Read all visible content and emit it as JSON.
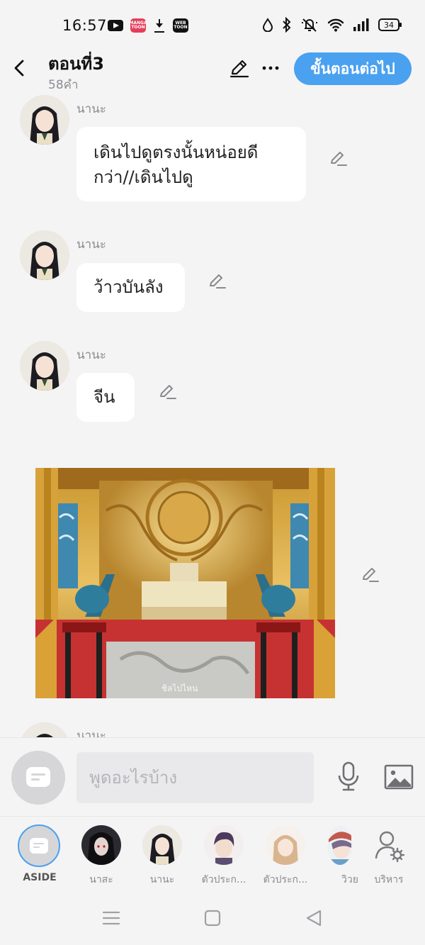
{
  "status_bar": {
    "time": "16:57",
    "app_badge_1": "MANGA TOON",
    "app_badge_2": "WEB TOON",
    "battery": "34"
  },
  "header": {
    "title": "ตอนที่3",
    "word_count": "58คำ",
    "next_button": "ขั้นตอนต่อไป"
  },
  "messages": [
    {
      "speaker": "นานะ",
      "text_lines": [
        "เดินไปดูตรงนั้นหน่อยดี",
        "กว่า//เดินไปดู"
      ]
    },
    {
      "speaker": "นานะ",
      "text": "ว้าวบันลัง"
    },
    {
      "speaker": "นานะ",
      "text": "จีน"
    },
    {
      "type": "image",
      "watermark": "ชิลไปไหน"
    },
    {
      "speaker": "นานะ"
    }
  ],
  "input": {
    "placeholder": "พูดอะไรบ้าง"
  },
  "characters": [
    {
      "label": "ASIDE",
      "icon": "chat-bubble-icon"
    },
    {
      "label": "นาสะ"
    },
    {
      "label": "นานะ"
    },
    {
      "label": "ตัวประก..."
    },
    {
      "label": "ตัวประก..."
    },
    {
      "label": "วิวย"
    },
    {
      "label": "บริหาร",
      "icon": "user-settings-icon"
    }
  ],
  "colors": {
    "accent": "#4aa1f0",
    "background": "#f4f4f5",
    "bubble": "#ffffff"
  }
}
